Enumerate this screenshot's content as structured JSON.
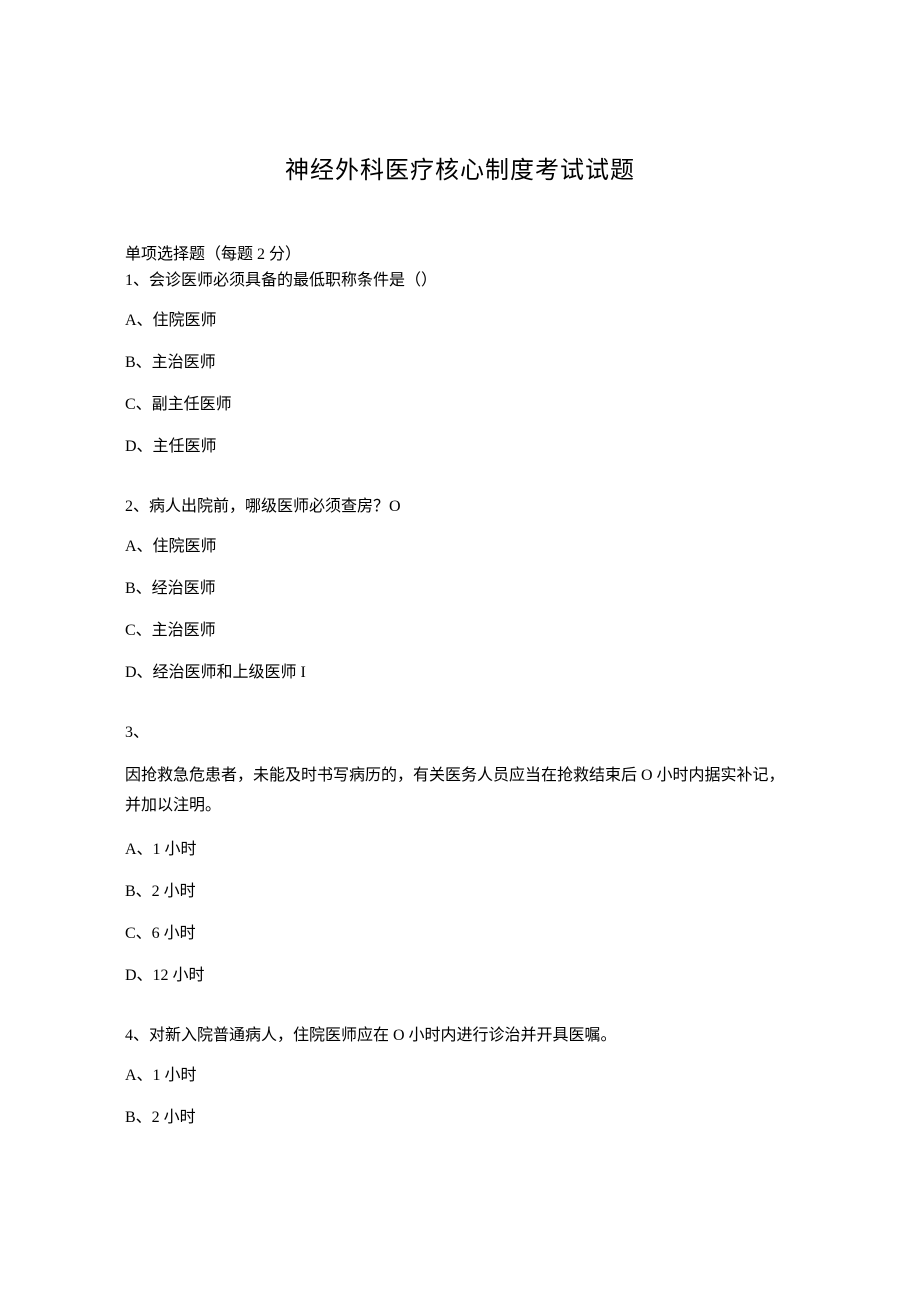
{
  "title": "神经外科医疗核心制度考试试题",
  "section_intro": "单项选择题（每题 2 分）",
  "q1": {
    "stem": "1、会诊医师必须具备的最低职称条件是（）",
    "a": "A、住院医师",
    "b": "B、主治医师",
    "c": "C、副主任医师",
    "d": "D、主任医师"
  },
  "q2": {
    "stem": "2、病人出院前，哪级医师必须查房？O",
    "a": "A、住院医师",
    "b": "B、经治医师",
    "c": "C、主治医师",
    "d": "D、经治医师和上级医师 I"
  },
  "q3": {
    "num": "3、",
    "stem": "因抢救急危患者，未能及时书写病历的，有关医务人员应当在抢救结束后 O 小时内据实补记，并加以注明。",
    "a": "A、1 小时",
    "b": "B、2 小时",
    "c": "C、6 小时",
    "d": "D、12 小时"
  },
  "q4": {
    "stem": "4、对新入院普通病人，住院医师应在 O 小时内进行诊治并开具医嘱。",
    "a": "A、1 小时",
    "b": "B、2 小时"
  }
}
